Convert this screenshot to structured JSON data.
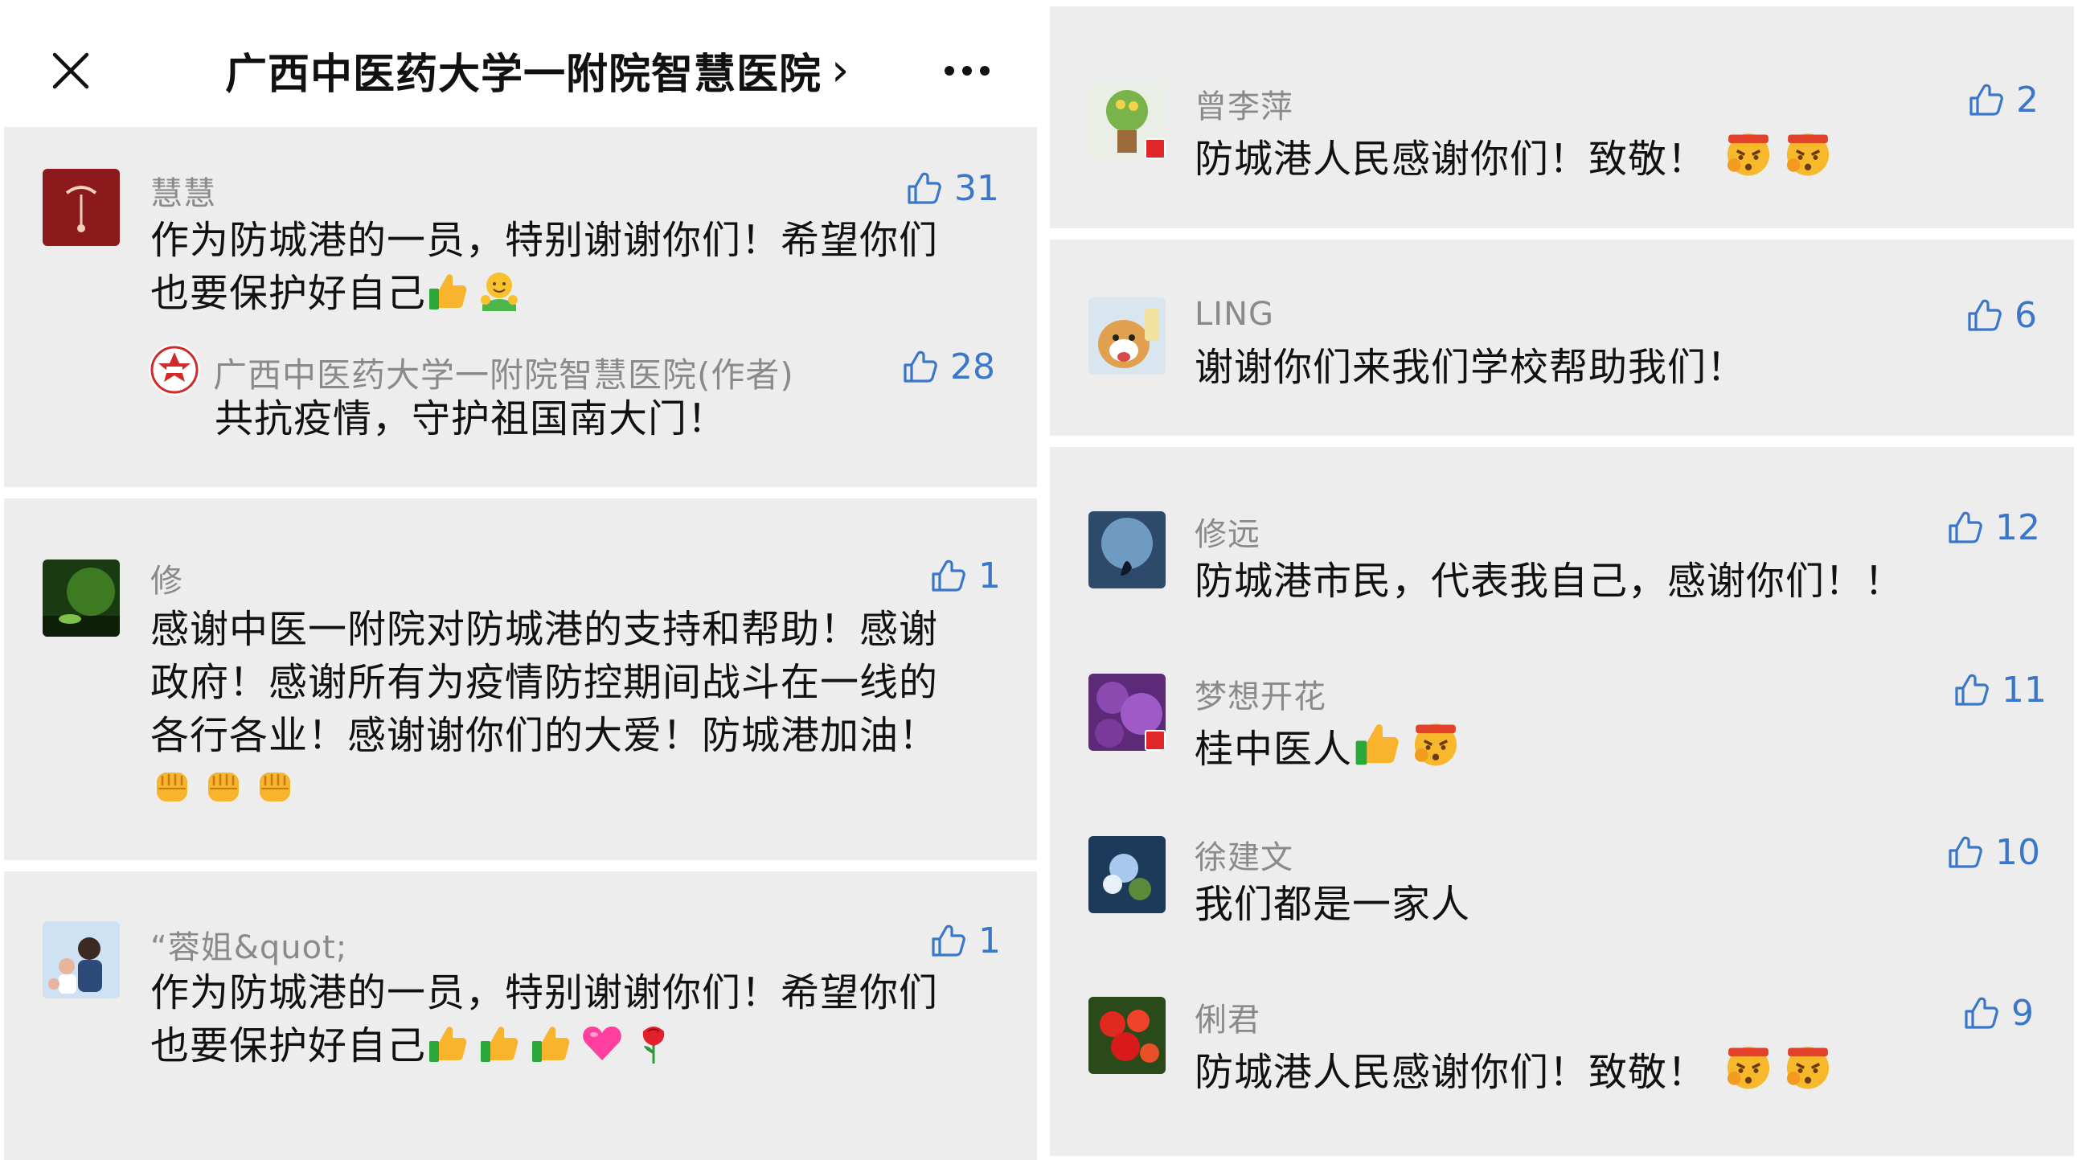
{
  "header": {
    "title": "广西中医药大学一附院智慧医院",
    "chevron": "›",
    "close_icon": "close-icon",
    "more_icon": "more-icon"
  },
  "left_comments": [
    {
      "name": "慧慧",
      "likes": "31",
      "lines": [
        "作为防城港的一员，特别谢谢你们！希望你们",
        "也要保护好自己"
      ],
      "emojis": [
        "thumbs-up",
        "hugging-face"
      ],
      "reply": {
        "name": "广西中医药大学一附院智慧医院(作者)",
        "likes": "28",
        "text": "共抗疫情，守护祖国南大门！"
      }
    },
    {
      "name": "修",
      "likes": "1",
      "lines": [
        "感谢中医一附院对防城港的支持和帮助！感谢",
        "政府！感谢所有为疫情防控期间战斗在一线的",
        "各行各业！感谢谢你们的大爱！防城港加油！"
      ],
      "emojis": [
        "raised-fist",
        "raised-fist",
        "raised-fist"
      ]
    },
    {
      "name": "“蓉姐&quot;",
      "likes": "1",
      "lines": [
        "作为防城港的一员，特别谢谢你们！希望你们",
        "也要保护好自己"
      ],
      "emojis": [
        "thumbs-up",
        "thumbs-up",
        "thumbs-up",
        "pink-heart",
        "rose"
      ]
    }
  ],
  "right_comments": [
    {
      "name": "曾李萍",
      "likes": "2",
      "text": "防城港人民感谢你们！致敬！",
      "emojis": [
        "determined-face",
        "determined-face"
      ]
    },
    {
      "name": "LING",
      "likes": "6",
      "text": "谢谢你们来我们学校帮助我们！",
      "emojis": []
    },
    {
      "name": "修远",
      "likes": "12",
      "text": "防城港市民，代表我自己，感谢你们！！",
      "emojis": []
    },
    {
      "name": "梦想开花",
      "likes": "11",
      "text": "桂中医人",
      "emojis": [
        "thumbs-up",
        "determined-face"
      ]
    },
    {
      "name": "徐建文",
      "likes": "10",
      "text": "我们都是一家人",
      "emojis": []
    },
    {
      "name": "俐君",
      "likes": "9",
      "text": "防城港人民感谢你们！致敬！",
      "emojis": [
        "determined-face",
        "determined-face"
      ]
    }
  ],
  "colors": {
    "like_blue": "#3b77c8",
    "name_gray": "#8a8a8a",
    "card_bg": "#ededed"
  }
}
